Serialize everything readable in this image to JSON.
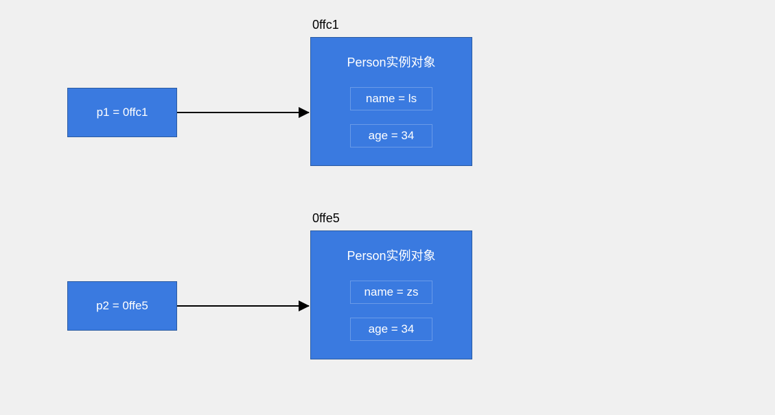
{
  "pointers": {
    "p1": {
      "label": "p1 = 0ffc1"
    },
    "p2": {
      "label": "p2 = 0ffe5"
    }
  },
  "objects": {
    "obj1": {
      "address": "0ffc1",
      "title": "Person实例对象",
      "field1": "name = ls",
      "field2": "age = 34"
    },
    "obj2": {
      "address": "0ffe5",
      "title": "Person实例对象",
      "field1": "name = zs",
      "field2": "age = 34"
    }
  }
}
